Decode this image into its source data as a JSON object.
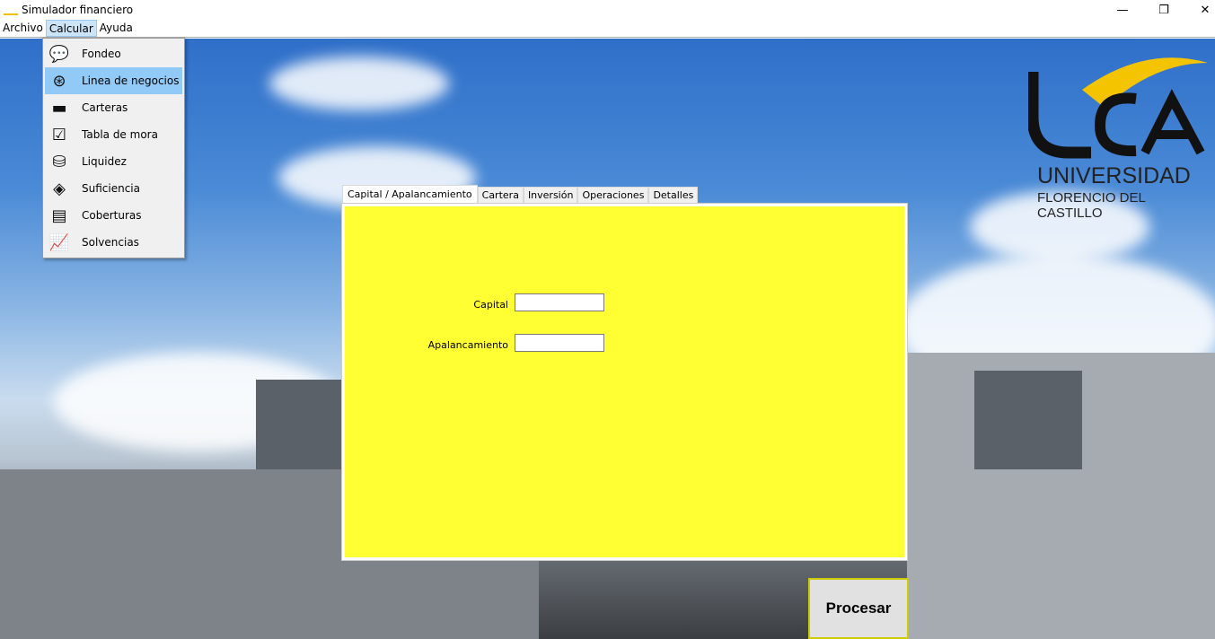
{
  "window": {
    "title": "Simulador financiero",
    "app_icon": "uca-icon",
    "controls": [
      "minimize",
      "restore",
      "close"
    ]
  },
  "menubar": [
    {
      "label": "Archivo"
    },
    {
      "label": "Calcular"
    },
    {
      "label": "Ayuda"
    }
  ],
  "dropdown": {
    "items": [
      {
        "label": "Fondeo",
        "icon": "money-chat-icon"
      },
      {
        "label": "Linea de negocios",
        "icon": "dollar-search-icon"
      },
      {
        "label": "Carteras",
        "icon": "banknotes-icon"
      },
      {
        "label": "Tabla de mora",
        "icon": "checklist-icon"
      },
      {
        "label": "Liquidez",
        "icon": "coins-icon"
      },
      {
        "label": "Suficiencia",
        "icon": "percent-tag-icon"
      },
      {
        "label": "Coberturas",
        "icon": "document-dollar-icon"
      },
      {
        "label": "Solvencias",
        "icon": "chart-icon"
      }
    ],
    "selected": "Linea de negocios"
  },
  "tabs": [
    {
      "label": "Capital / Apalancamiento"
    },
    {
      "label": "Cartera"
    },
    {
      "label": "Inversión"
    },
    {
      "label": "Operaciones"
    },
    {
      "label": "Detalles"
    }
  ],
  "form": {
    "capital_label": "Capital",
    "capital_value": "",
    "apalancamiento_label": "Apalancamiento",
    "apalancamiento_value": ""
  },
  "process_button": "Procesar",
  "logo": {
    "mark": "UCA",
    "line1": "UNIVERSIDAD",
    "line2": "FLORENCIO DEL CASTILLO"
  },
  "colors": {
    "panel": "#ffff33",
    "menu_highlight": "#91c9f7"
  }
}
